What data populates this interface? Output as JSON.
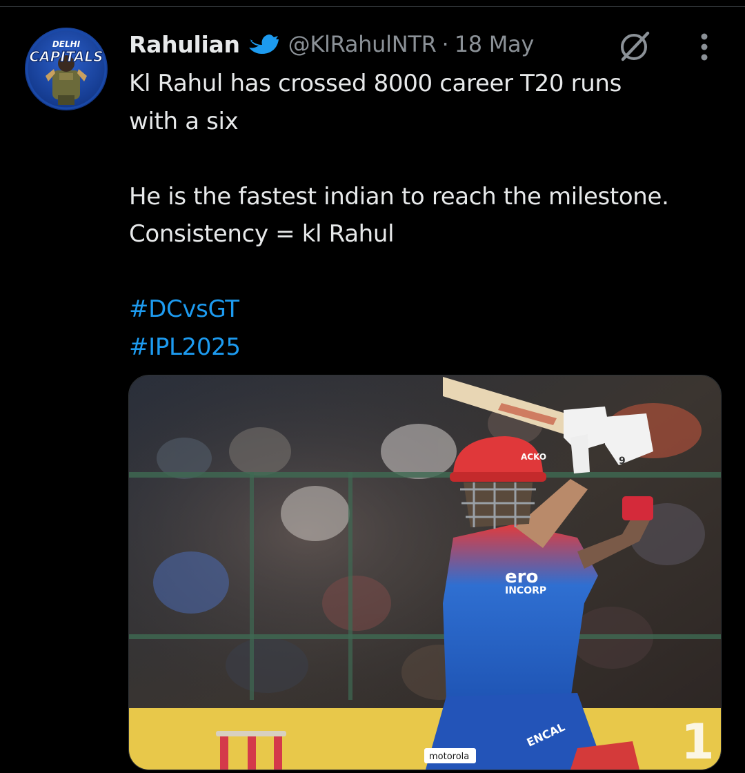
{
  "tweet": {
    "author": {
      "display_name": "Rahulian",
      "badge_icon": "bird-icon",
      "handle": "@KlRahulNTR",
      "avatar_text_top": "DELHI",
      "avatar_text_bottom": "CAPITALS"
    },
    "separator": "·",
    "date": "18 May",
    "text": {
      "line1": "Kl Rahul has crossed 8000 career T20 runs",
      "line2": "with a six",
      "line3": "He is the fastest indian to reach the milestone.",
      "line4": "Consistency = kl Rahul"
    },
    "hashtags": [
      "#DCvsGT",
      "#IPL2025"
    ],
    "actions": {
      "grok_icon": "grok-icon",
      "more_icon": "more-vertical-icon"
    },
    "media": {
      "helmet_sponsor": "ACKO",
      "jersey_sponsor_line1": "ero",
      "jersey_sponsor_line2": "INCORP",
      "pad_brand": "ENCAL",
      "glove_mark": "9",
      "trouser_sponsor": "motorola"
    }
  },
  "colors": {
    "background": "#000000",
    "text_primary": "#e7e9ea",
    "text_secondary": "#8b9197",
    "hashtag": "#1d9bf0",
    "bird_badge": "#1d9bf0"
  }
}
